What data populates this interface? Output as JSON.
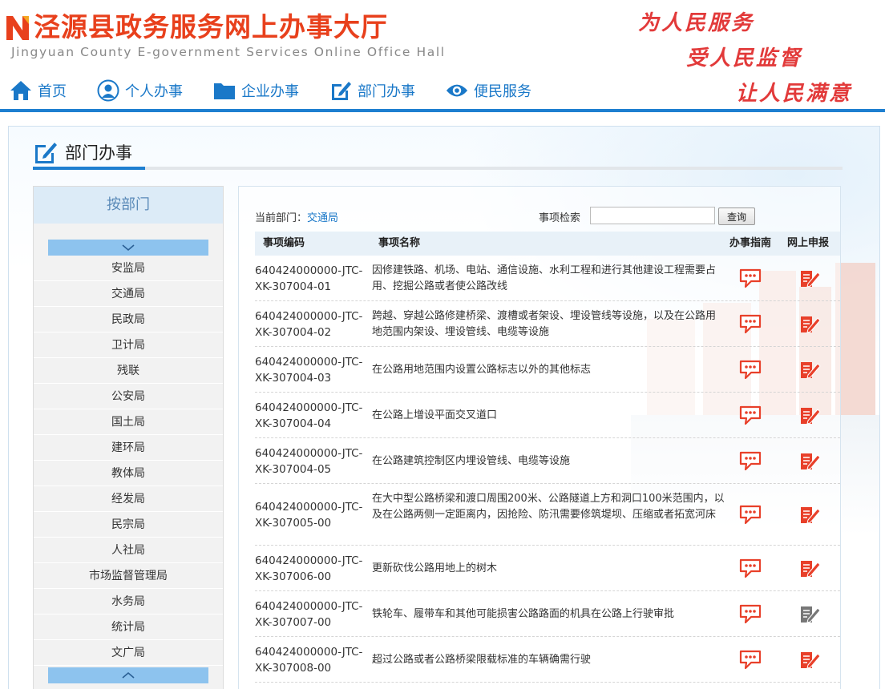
{
  "header": {
    "title": "泾源县政务服务网上办事大厅",
    "subtitle": "Jingyuan County E-government Services Online Office Hall",
    "slogans": [
      "为人民服务",
      "受人民监督",
      "让人民满意"
    ],
    "brand_color": "#e8401c",
    "accent_color": "#1e7fd0"
  },
  "nav": {
    "items": [
      {
        "label": "首页",
        "icon": "home-icon"
      },
      {
        "label": "个人办事",
        "icon": "person-icon"
      },
      {
        "label": "企业办事",
        "icon": "folder-icon"
      },
      {
        "label": "部门办事",
        "icon": "edit-icon"
      },
      {
        "label": "便民服务",
        "icon": "eye-icon"
      }
    ]
  },
  "section": {
    "title": "部门办事"
  },
  "sidebar": {
    "title": "按部门",
    "items": [
      "安监局",
      "交通局",
      "民政局",
      "卫计局",
      "残联",
      "公安局",
      "国土局",
      "建环局",
      "教体局",
      "经发局",
      "民宗局",
      "人社局",
      "市场监督管理局",
      "水务局",
      "统计局",
      "文广局"
    ]
  },
  "content": {
    "crumb_label": "当前部门：",
    "current_dept": "交通局",
    "search_label": "事项检索",
    "search_value": "",
    "search_button": "查询",
    "columns": [
      "事项编码",
      "事项名称",
      "办事指南",
      "网上申报"
    ],
    "rows": [
      {
        "code": "640424000000-JTC-XK-307004-01",
        "name": "因修建铁路、机场、电站、通信设施、水利工程和进行其他建设工程需要占用、挖掘公路或者使公路改线",
        "apply_enabled": true
      },
      {
        "code": "640424000000-JTC-XK-307004-02",
        "name": "跨越、穿越公路修建桥梁、渡槽或者架设、埋设管线等设施，以及在公路用地范围内架设、埋设管线、电缆等设施",
        "apply_enabled": true
      },
      {
        "code": "640424000000-JTC-XK-307004-03",
        "name": "在公路用地范围内设置公路标志以外的其他标志",
        "apply_enabled": true
      },
      {
        "code": "640424000000-JTC-XK-307004-04",
        "name": "在公路上增设平面交叉道口",
        "apply_enabled": true
      },
      {
        "code": "640424000000-JTC-XK-307004-05",
        "name": "在公路建筑控制区内埋设管线、电缆等设施",
        "apply_enabled": true
      },
      {
        "code": "640424000000-JTC-XK-307005-00",
        "name": "在大中型公路桥梁和渡口周围200米、公路隧道上方和洞口100米范围内，以及在公路两侧一定距离内，因抢险、防汛需要修筑堤坝、压缩或者拓宽河床",
        "apply_enabled": true
      },
      {
        "code": "640424000000-JTC-XK-307006-00",
        "name": "更新砍伐公路用地上的树木",
        "apply_enabled": true
      },
      {
        "code": "640424000000-JTC-XK-307007-00",
        "name": "铁轮车、履带车和其他可能损害公路路面的机具在公路上行驶审批",
        "apply_enabled": false
      },
      {
        "code": "640424000000-JTC-XK-307008-00",
        "name": "超过公路或者公路桥梁限载标准的车辆确需行驶",
        "apply_enabled": true
      }
    ]
  }
}
